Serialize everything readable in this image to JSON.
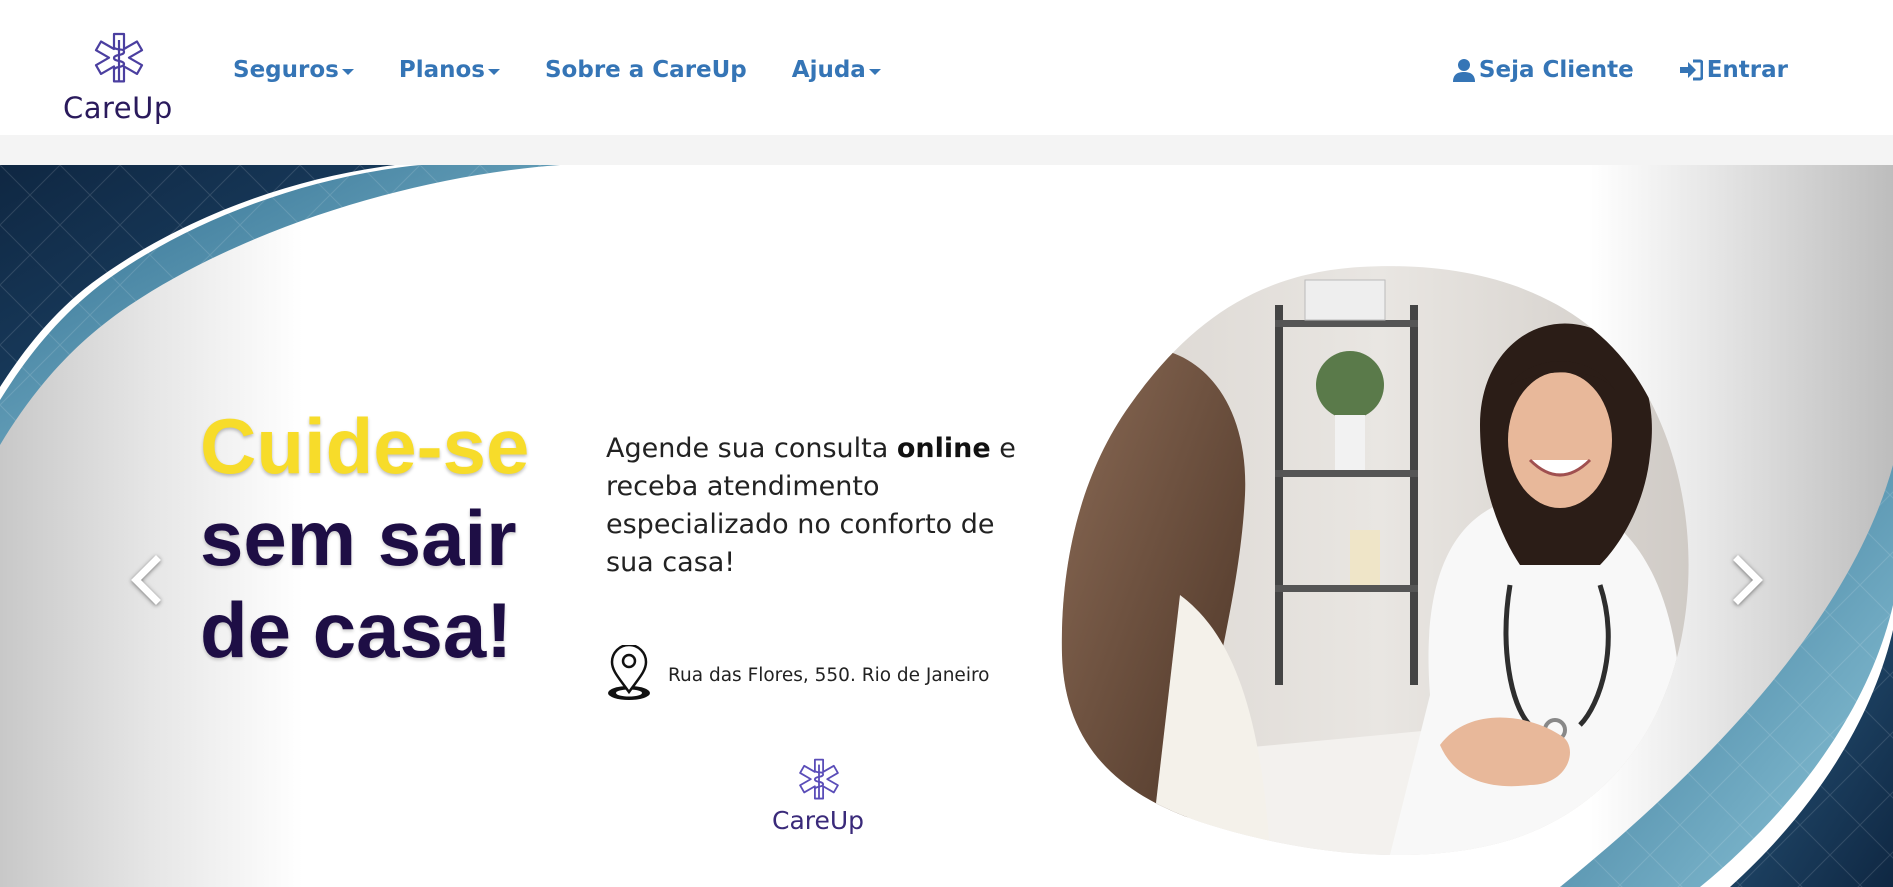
{
  "brand": {
    "name": "CareUp",
    "icon": "caduceus-star-icon",
    "color": "#2a1a5c"
  },
  "nav": {
    "left": [
      {
        "label": "Seguros",
        "dropdown": true
      },
      {
        "label": "Planos",
        "dropdown": true
      },
      {
        "label": "Sobre a CareUp",
        "dropdown": false
      },
      {
        "label": "Ajuda",
        "dropdown": true
      }
    ],
    "right": [
      {
        "label": "Seja Cliente",
        "icon": "user-icon"
      },
      {
        "label": "Entrar",
        "icon": "sign-in-icon"
      }
    ],
    "link_color": "#3575b6"
  },
  "hero": {
    "headline": {
      "line1": "Cuide-se",
      "line2": "sem sair",
      "line3": "de casa!",
      "accent_color": "#f7dc2a",
      "dark_color": "#1e0e45"
    },
    "description": {
      "part1": "Agende sua consulta ",
      "bold": "online",
      "part2": " e receba atendimento especializado no conforto de sua casa!"
    },
    "address": {
      "icon": "map-pin-icon",
      "text": "Rua das Flores, 550. Rio de Janeiro"
    },
    "logo_text": "CareUp",
    "image": "doctor-consultation-photo",
    "prev_icon": "chevron-left-icon",
    "next_icon": "chevron-right-icon"
  }
}
